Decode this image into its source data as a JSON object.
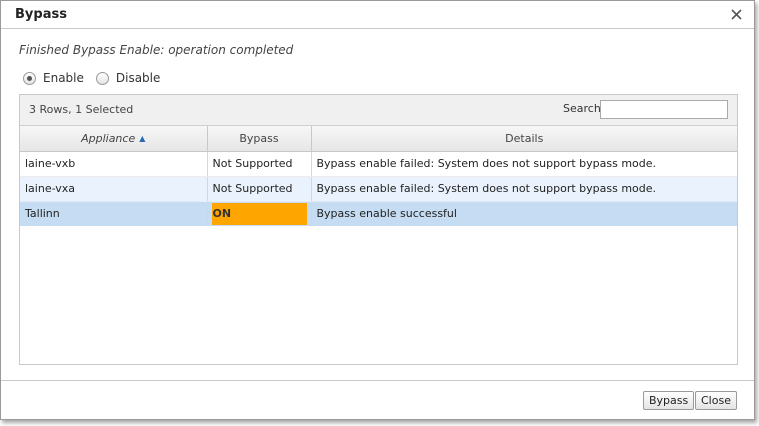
{
  "dialog": {
    "title": "Bypass",
    "status_message": "Finished Bypass Enable: operation completed",
    "close_icon": "close-icon"
  },
  "mode": {
    "options": [
      "Enable",
      "Disable"
    ],
    "selected": "Enable"
  },
  "grid": {
    "summary": "3 Rows, 1 Selected",
    "search_label": "Search",
    "search_value": "",
    "columns": [
      "Appliance",
      "Bypass",
      "Details"
    ],
    "sort_column": "Appliance",
    "sort_direction": "ascending",
    "rows": [
      {
        "appliance": "laine-vxb",
        "bypass": "Not Supported",
        "details": "Bypass enable failed: System does not support bypass mode.",
        "selected": false
      },
      {
        "appliance": "laine-vxa",
        "bypass": "Not Supported",
        "details": "Bypass enable failed: System does not support bypass mode.",
        "selected": false
      },
      {
        "appliance": "Tallinn",
        "bypass": "ON",
        "details": "Bypass enable successful",
        "selected": true
      }
    ]
  },
  "buttons": {
    "bypass_label": "Bypass",
    "close_label": "Close"
  },
  "colors": {
    "selected_row": "#c5dcf3",
    "alt_row": "#eaf3fd",
    "on_badge": "#ffa500",
    "sort_arrow": "#2a6bb5"
  }
}
